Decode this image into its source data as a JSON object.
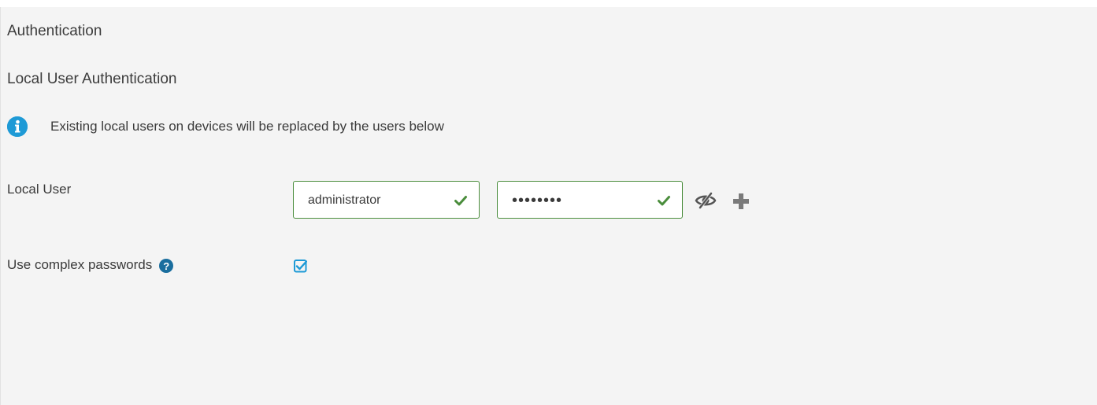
{
  "section": {
    "title": "Authentication"
  },
  "local_auth": {
    "title": "Local User Authentication",
    "info_text": "Existing local users on devices will be replaced by the users below",
    "local_user_label": "Local User",
    "username_value": "administrator",
    "password_value": "••••••••",
    "complex_passwords_label": "Use complex passwords",
    "complex_passwords_checked": true,
    "help_glyph": "?"
  },
  "icons": {
    "info": "info-icon",
    "valid": "checkmark-icon",
    "toggle_visibility": "eye-slash-icon",
    "add": "plus-icon",
    "help": "question-circle-icon"
  },
  "colors": {
    "panel_bg": "#f4f4f4",
    "info_blue": "#1e9ad6",
    "valid_green": "#4a8d3c",
    "checkbox_blue": "#1e9ad6"
  }
}
